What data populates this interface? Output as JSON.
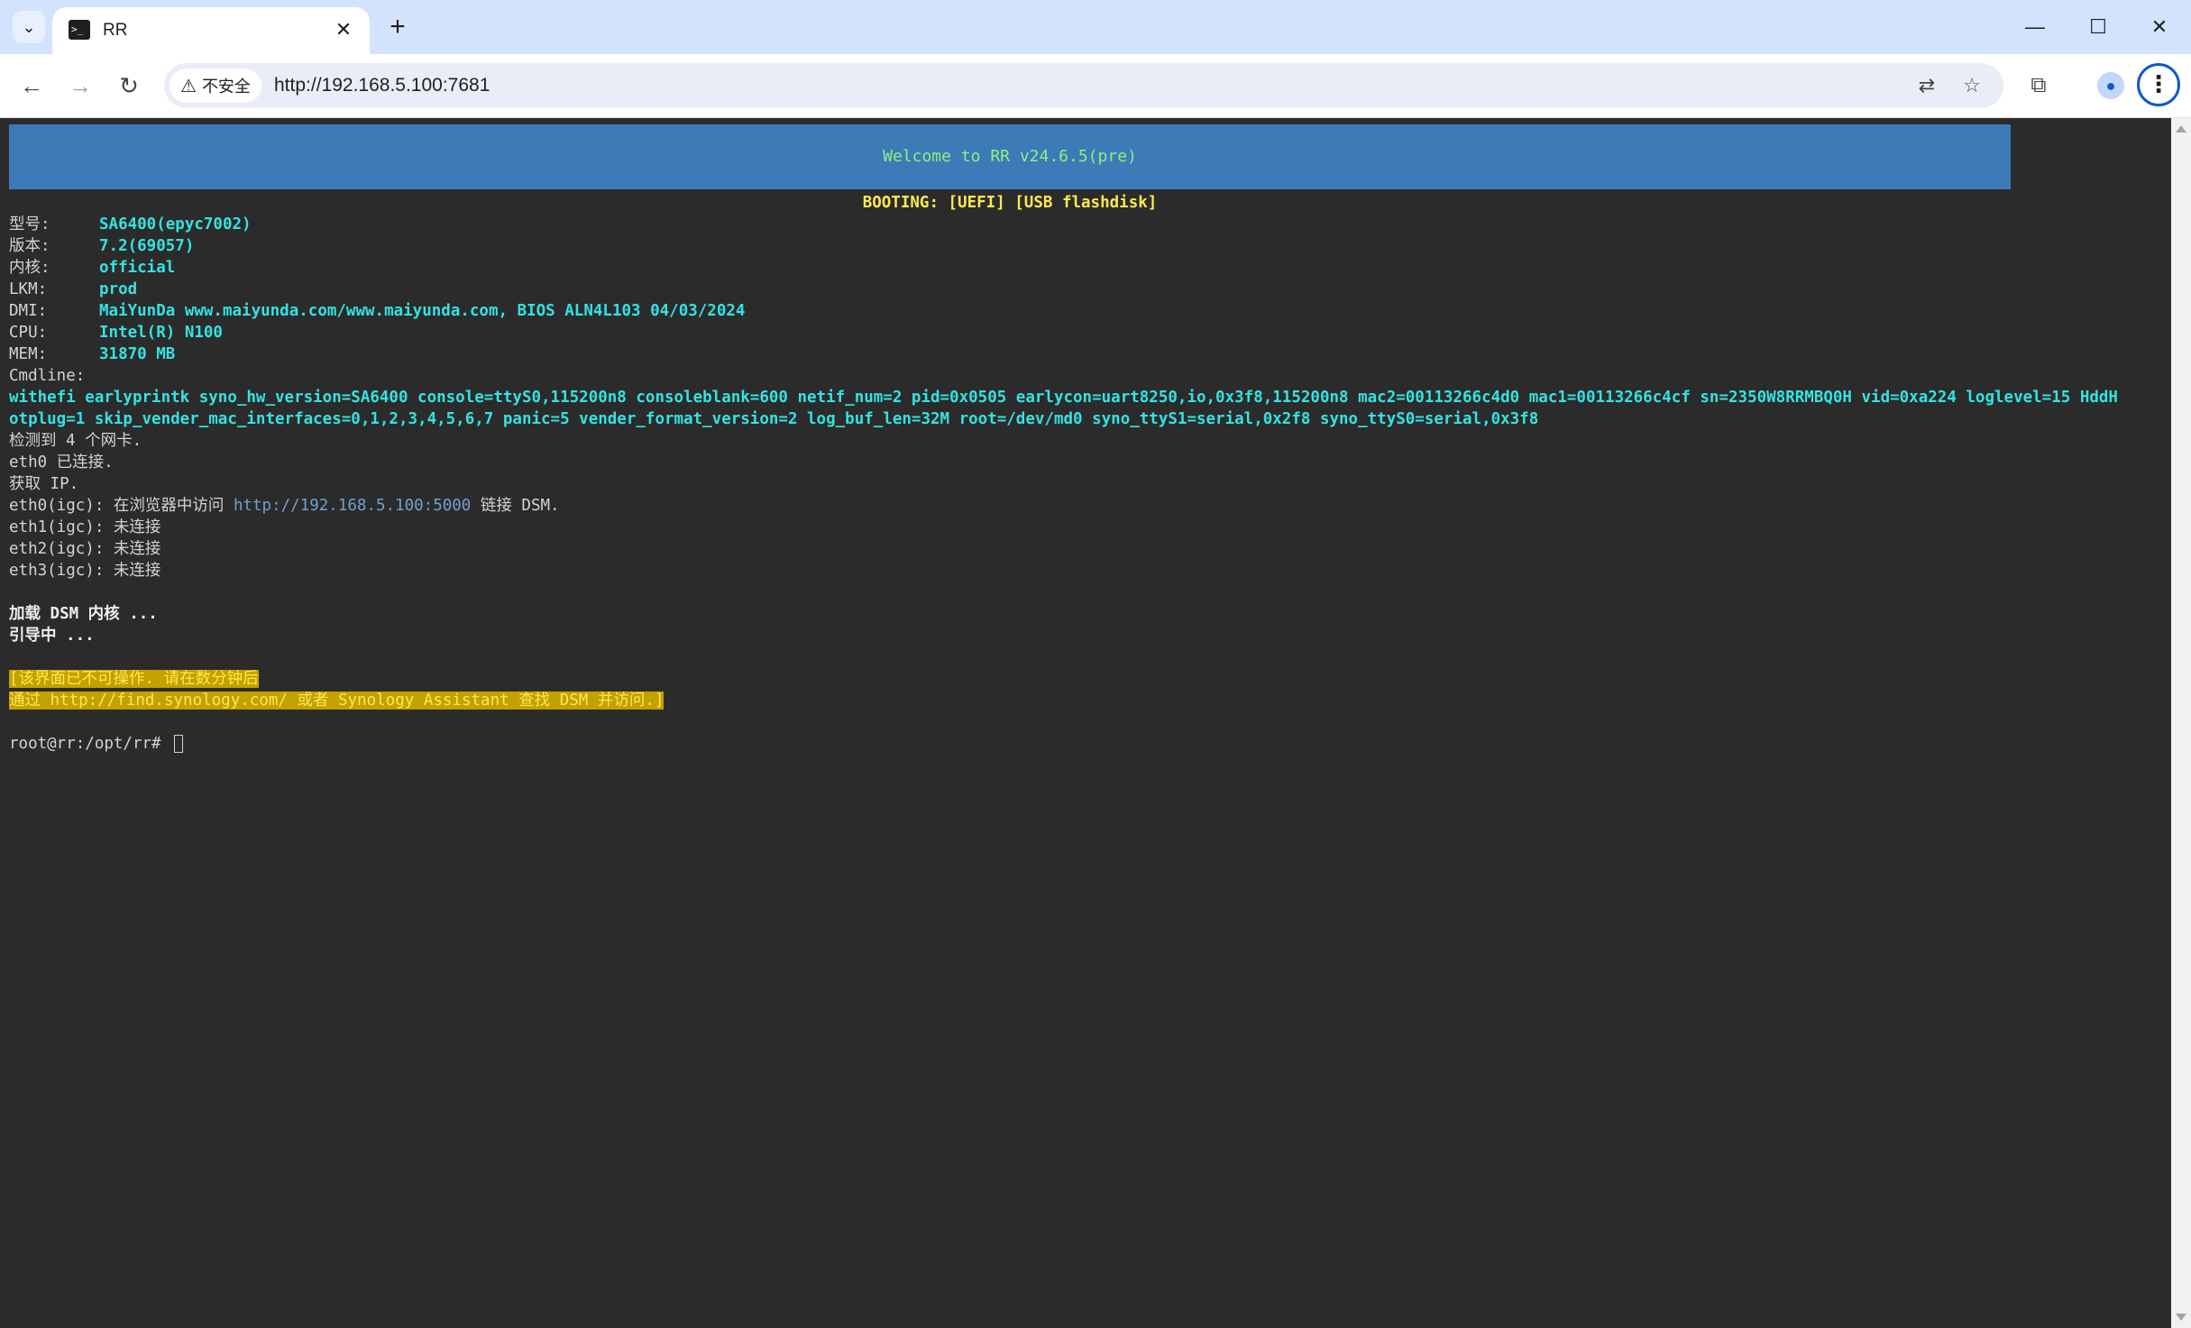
{
  "browser": {
    "tab_title": "RR",
    "url": "http://192.168.5.100:7681",
    "security_label": "不安全",
    "favicon_text": ">_"
  },
  "terminal": {
    "banner": "Welcome to RR v24.6.5(pre)",
    "booting": "BOOTING: [UEFI] [USB flashdisk]",
    "info": [
      {
        "label": "型号:",
        "value": "SA6400(epyc7002)"
      },
      {
        "label": "版本:",
        "value": "7.2(69057)"
      },
      {
        "label": "内核:",
        "value": "official"
      },
      {
        "label": "LKM:",
        "value": "prod"
      },
      {
        "label": "DMI:",
        "value": "MaiYunDa www.maiyunda.com/www.maiyunda.com, BIOS ALN4L103 04/03/2024"
      },
      {
        "label": "CPU:",
        "value": "Intel(R) N100"
      },
      {
        "label": "MEM:",
        "value": "31870 MB"
      }
    ],
    "cmdline_label": "Cmdline:",
    "cmdline_1": "withefi earlyprintk syno_hw_version=SA6400 console=ttyS0,115200n8 consoleblank=600 netif_num=2 pid=0x0505 earlycon=uart8250,io,0x3f8,115200n8 mac2=00113266c4d0 mac1=00113266c4cf sn=2350W8RRMBQ0H vid=0xa224 loglevel=15 HddH",
    "cmdline_2": "otplug=1 skip_vender_mac_interfaces=0,1,2,3,4,5,6,7 panic=5 vender_format_version=2 log_buf_len=32M root=/dev/md0 syno_ttyS1=serial,0x2f8 syno_ttyS0=serial,0x3f8",
    "nic_detected": "检测到 4 个网卡.",
    "eth0_connected": "eth0 已连接.",
    "get_ip": "获取 IP.",
    "eth0_prefix": "eth0(igc): 在浏览器中访问 ",
    "eth0_link": "http://192.168.5.100:5000",
    "eth0_suffix": " 链接 DSM.",
    "eth1": "eth1(igc): 未连接",
    "eth2": "eth2(igc): 未连接",
    "eth3": "eth3(igc): 未连接",
    "loading": "加载 DSM 内核 ...",
    "booting_msg": "引导中 ...",
    "notice_1": "[该界面已不可操作. 请在数分钟后",
    "notice_2": "通过 http://find.synology.com/ 或者 Synology Assistant 查找 DSM 并访问.]",
    "prompt": "root@rr:/opt/rr# "
  }
}
